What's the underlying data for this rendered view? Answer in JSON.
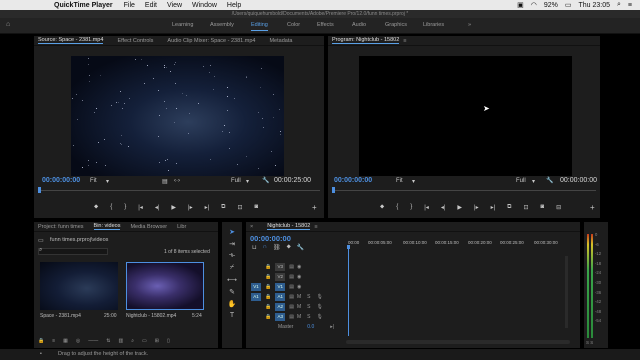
{
  "menubar": {
    "app_name": "QuickTime Player",
    "items": [
      "File",
      "Edit",
      "View",
      "Window",
      "Help"
    ],
    "battery": "92%",
    "clock": "Thu 23:05"
  },
  "window_title": "/Users/quiquehumbold/Documents/Adobe/Premiere Pro/12.0/funn times.prproj *",
  "workspaces": [
    "Learning",
    "Assembly",
    "Editing",
    "Color",
    "Effects",
    "Audio",
    "Graphics",
    "Libraries"
  ],
  "more_glyph": "»",
  "active_workspace": "Editing",
  "source_panel": {
    "tabs": [
      "Source: Space - 2381.mp4",
      "Effect Controls",
      "Audio Clip Mixer: Space - 2381.mp4",
      "Metadata"
    ],
    "timecode_in": "00:00:00:00",
    "fit": "Fit",
    "full": "Full",
    "timecode_out": "00:00:25:00"
  },
  "program_panel": {
    "title": "Program: Nightclub - 15802",
    "timecode_in": "00:00:00:00",
    "fit": "Fit",
    "full": "Full",
    "timecode_out": "00:00:00:00"
  },
  "project_panel": {
    "tabs": [
      "Project: funn times",
      "Bin: videos",
      "Media Browser",
      "Libr"
    ],
    "path": "funn times.prproj\\videos",
    "selection": "1 of 8 items selected",
    "clips": [
      {
        "name": "Space - 2381.mp4",
        "duration": "25:00"
      },
      {
        "name": "Nightclub - 15802.mp4",
        "duration": "5:24"
      }
    ]
  },
  "timeline": {
    "title": "Nightclub - 15802",
    "timecode": "00:00:00:00",
    "ruler": [
      "00:00",
      "00:00:05:00",
      "00:00:10:00",
      "00:00:15:00",
      "00:00:20:00",
      "00:00:25:00",
      "00:00:30:00"
    ],
    "video_tracks": [
      "V3",
      "V2",
      "V1"
    ],
    "audio_tracks": [
      "A1",
      "A2",
      "A3"
    ],
    "track_src_labels": [
      "V1",
      "A1"
    ],
    "master_label": "Master",
    "master_value": "0.0"
  },
  "meter_labels": [
    "0",
    "-6",
    "-12",
    "-18",
    "-24",
    "-30",
    "-36",
    "-42",
    "-48",
    "-54"
  ],
  "meter_footer": "S  S",
  "status": "Drag to adjust the height of the track.",
  "colors": {
    "accent": "#4d8fe0",
    "panel_bg": "#1d1d1d"
  }
}
